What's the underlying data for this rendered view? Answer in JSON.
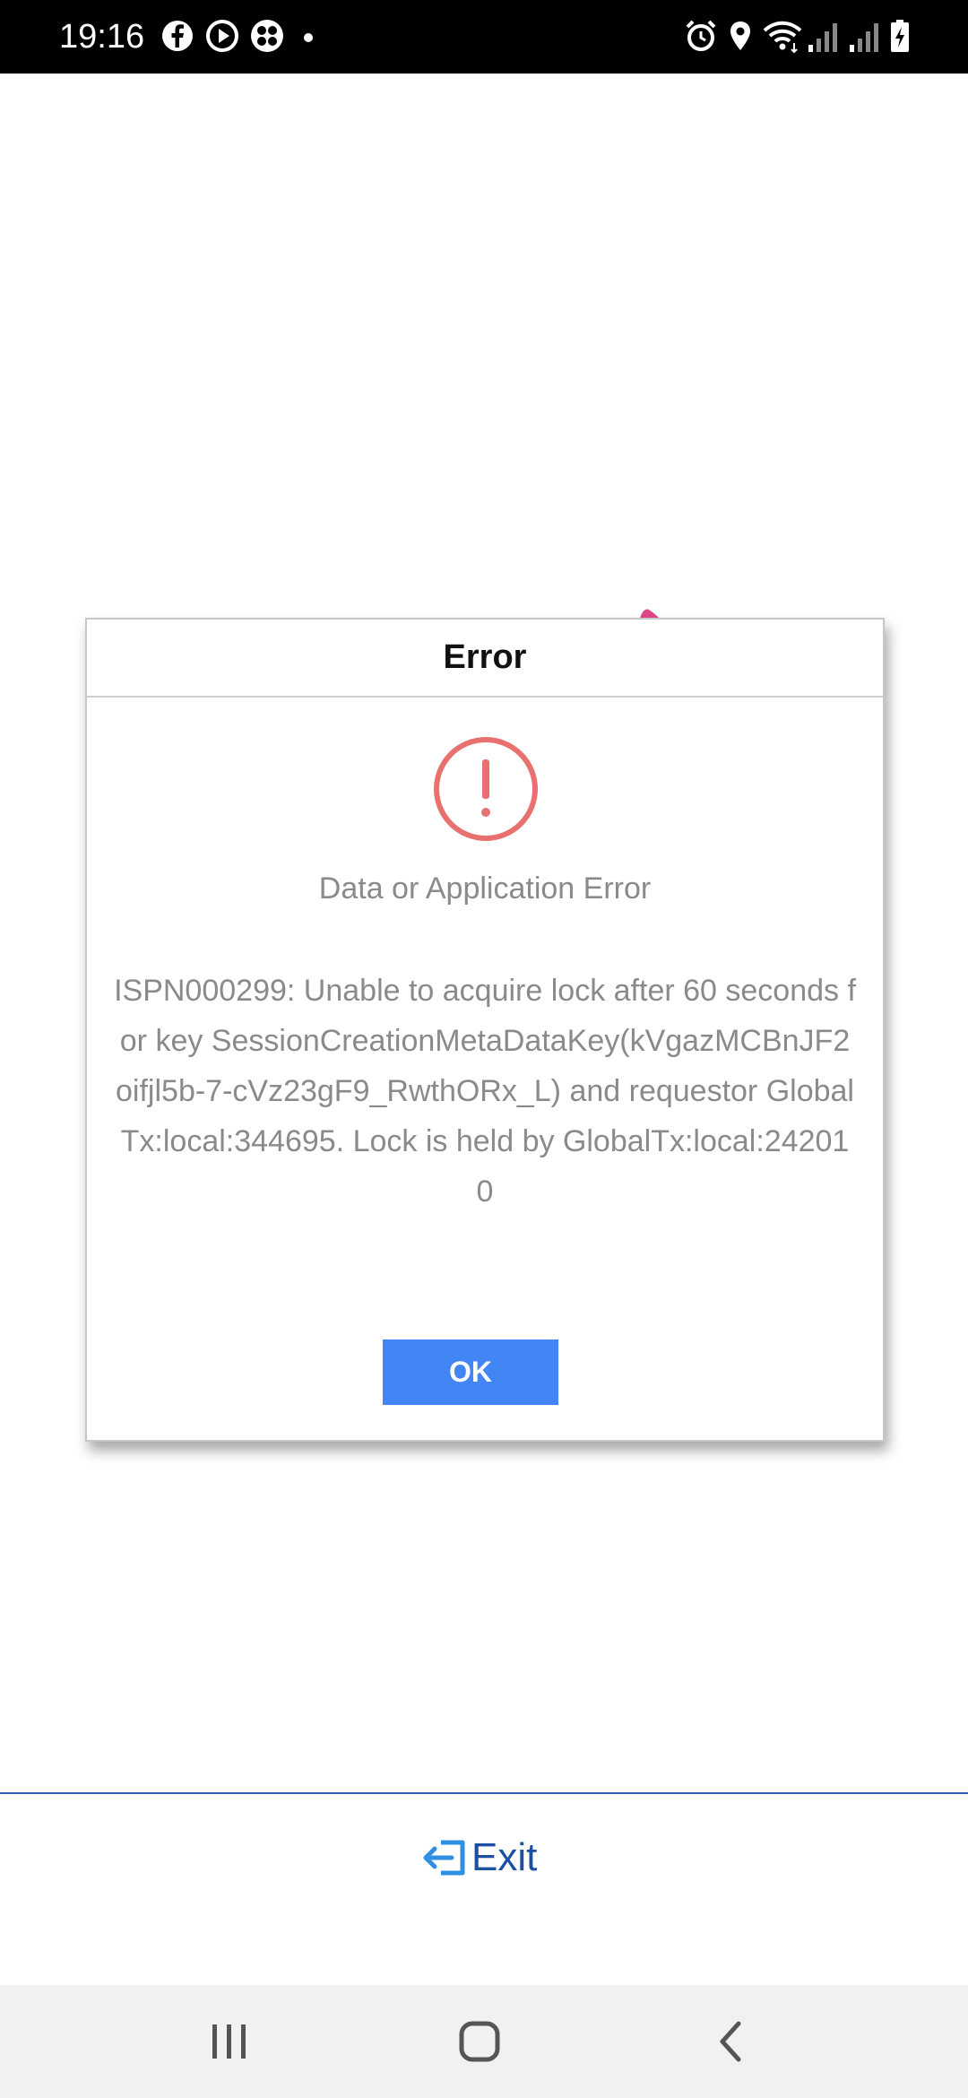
{
  "status_bar": {
    "time": "19:16",
    "left_icons": [
      "facebook-icon",
      "play-icon",
      "app-grid-icon",
      "dot-icon"
    ],
    "right_icons": [
      "alarm-icon",
      "location-icon",
      "wifi-icon",
      "signal-icon",
      "signal-icon",
      "battery-icon"
    ]
  },
  "dialog": {
    "title": "Error",
    "icon": "alert-circle-icon",
    "icon_color": "#e8706f",
    "subtitle": "Data or Application Error",
    "message": "ISPN000299: Unable to acquire lock after 60 seconds for key SessionCreationMetaDataKey(kVgazMCBnJF2oifjl5b-7-cVz23gF9_RwthORx_L) and requestor GlobalTx:local:344695. Lock is held by GlobalTx:local:242010",
    "ok_label": "OK",
    "ok_color": "#4285f4"
  },
  "footer": {
    "exit_label": "Exit",
    "exit_icon": "exit-icon",
    "link_color": "#1a4fa3"
  },
  "nav_bar": {
    "buttons": [
      "recent-apps-icon",
      "home-icon",
      "back-icon"
    ]
  }
}
